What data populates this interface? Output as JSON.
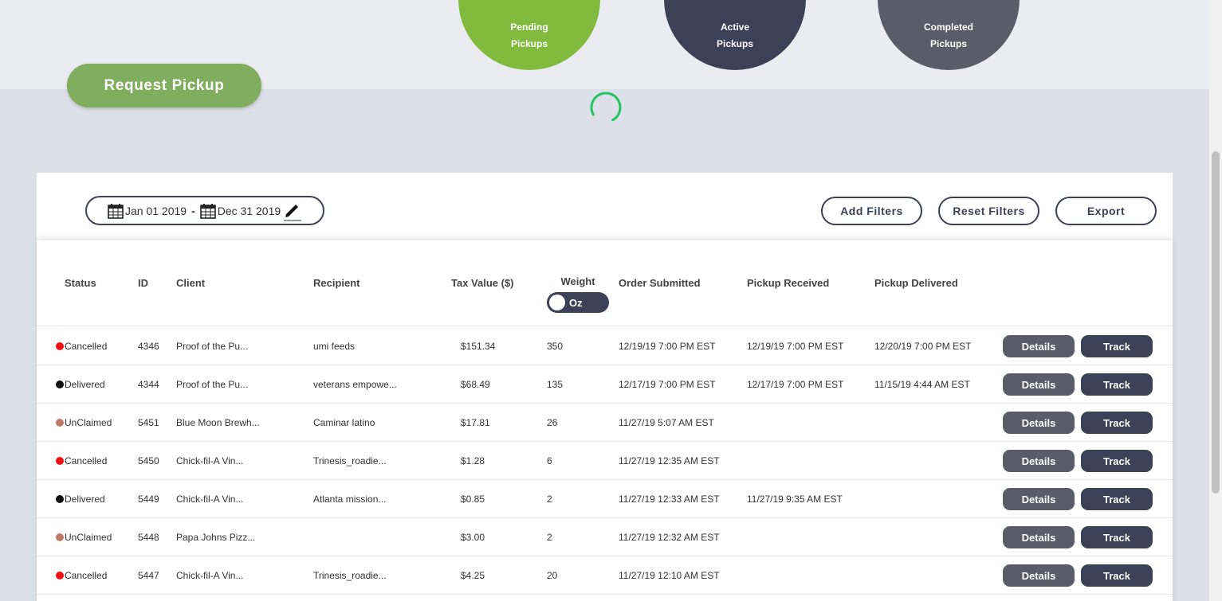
{
  "summary": {
    "pending": {
      "line1": "Pending",
      "line2": "Pickups",
      "color": "#82ba3e"
    },
    "active": {
      "line1": "Active",
      "line2": "Pickups",
      "color": "#3c4157"
    },
    "completed": {
      "line1": "Completed",
      "line2": "Pickups",
      "color": "#5a5c67"
    }
  },
  "request_button": "Request Pickup",
  "loading_spinner": {
    "icon": "spinner-icon",
    "color": "#22c55e"
  },
  "filters": {
    "start_date": "Jan 01 2019",
    "separator": "-",
    "end_date": "Dec 31 2019",
    "calendar_icon": "calendar-icon",
    "edit_icon": "pencil-icon",
    "add_filters": "Add Filters",
    "reset_filters": "Reset Filters",
    "export": "Export"
  },
  "columns": {
    "status": "Status",
    "id": "ID",
    "client": "Client",
    "recipient": "Recipient",
    "tax_value": "Tax Value ($)",
    "weight": "Weight",
    "weight_unit": "Oz",
    "order_submitted": "Order Submitted",
    "pickup_received": "Pickup Received",
    "pickup_delivered": "Pickup Delivered"
  },
  "status_colors": {
    "Cancelled": "#ee1111",
    "Delivered": "#111111",
    "UnClaimed": "#c07a66"
  },
  "row_actions": {
    "details": "Details",
    "track": "Track"
  },
  "rows": [
    {
      "status": "Cancelled",
      "id": "4346",
      "client": "Proof of the Pu...",
      "recipient": "umi feeds",
      "tax": "$151.34",
      "weight": "350",
      "submitted": "12/19/19 7:00 PM EST",
      "received": "12/19/19 7:00 PM EST",
      "delivered": "12/20/19 7:00 PM EST"
    },
    {
      "status": "Delivered",
      "id": "4344",
      "client": "Proof of the Pu...",
      "recipient": "veterans empowe...",
      "tax": "$68.49",
      "weight": "135",
      "submitted": "12/17/19 7:00 PM EST",
      "received": "12/17/19 7:00 PM EST",
      "delivered": "11/15/19 4:44 AM EST"
    },
    {
      "status": "UnClaimed",
      "id": "5451",
      "client": "Blue Moon Brewh...",
      "recipient": "Caminar latino",
      "tax": "$17.81",
      "weight": "26",
      "submitted": "11/27/19 5:07 AM EST",
      "received": "",
      "delivered": ""
    },
    {
      "status": "Cancelled",
      "id": "5450",
      "client": "Chick-fil-A Vin...",
      "recipient": "Trinesis_roadie...",
      "tax": "$1.28",
      "weight": "6",
      "submitted": "11/27/19 12:35 AM EST",
      "received": "",
      "delivered": ""
    },
    {
      "status": "Delivered",
      "id": "5449",
      "client": "Chick-fil-A Vin...",
      "recipient": "Atlanta mission...",
      "tax": "$0.85",
      "weight": "2",
      "submitted": "11/27/19 12:33 AM EST",
      "received": "11/27/19 9:35 AM EST",
      "delivered": ""
    },
    {
      "status": "UnClaimed",
      "id": "5448",
      "client": "Papa Johns Pizz...",
      "recipient": "",
      "tax": "$3.00",
      "weight": "2",
      "submitted": "11/27/19 12:32 AM EST",
      "received": "",
      "delivered": ""
    },
    {
      "status": "Cancelled",
      "id": "5447",
      "client": "Chick-fil-A Vin...",
      "recipient": "Trinesis_roadie...",
      "tax": "$4.25",
      "weight": "20",
      "submitted": "11/27/19 12:10 AM EST",
      "received": "",
      "delivered": ""
    }
  ]
}
